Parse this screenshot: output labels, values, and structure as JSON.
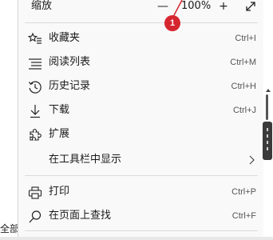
{
  "zoom": {
    "label": "缩放",
    "minus": "—",
    "value": "100%",
    "plus": "+",
    "fullscreen_icon": "expand-diagonal-icon"
  },
  "annotation": {
    "badge": "1",
    "color": "#d6262f"
  },
  "menu": {
    "items": [
      {
        "label": "收藏夹",
        "shortcut": "Ctrl+I",
        "icon": "favorites-star-list-icon"
      },
      {
        "label": "阅读列表",
        "shortcut": "Ctrl+M",
        "icon": "reading-list-icon"
      },
      {
        "label": "历史记录",
        "shortcut": "Ctrl+H",
        "icon": "history-clock-icon"
      },
      {
        "label": "下载",
        "shortcut": "Ctrl+J",
        "icon": "download-arrow-icon"
      },
      {
        "label": "扩展",
        "shortcut": "",
        "icon": "extensions-puzzle-icon"
      },
      {
        "label": "在工具栏中显示",
        "shortcut": "",
        "icon": "chevron-right-icon"
      },
      {
        "label": "打印",
        "shortcut": "Ctrl+P",
        "icon": "printer-icon"
      },
      {
        "label": "在页面上查找",
        "shortcut": "Ctrl+F",
        "icon": "search-icon"
      }
    ]
  },
  "background": {
    "fragment_text": "全部"
  }
}
